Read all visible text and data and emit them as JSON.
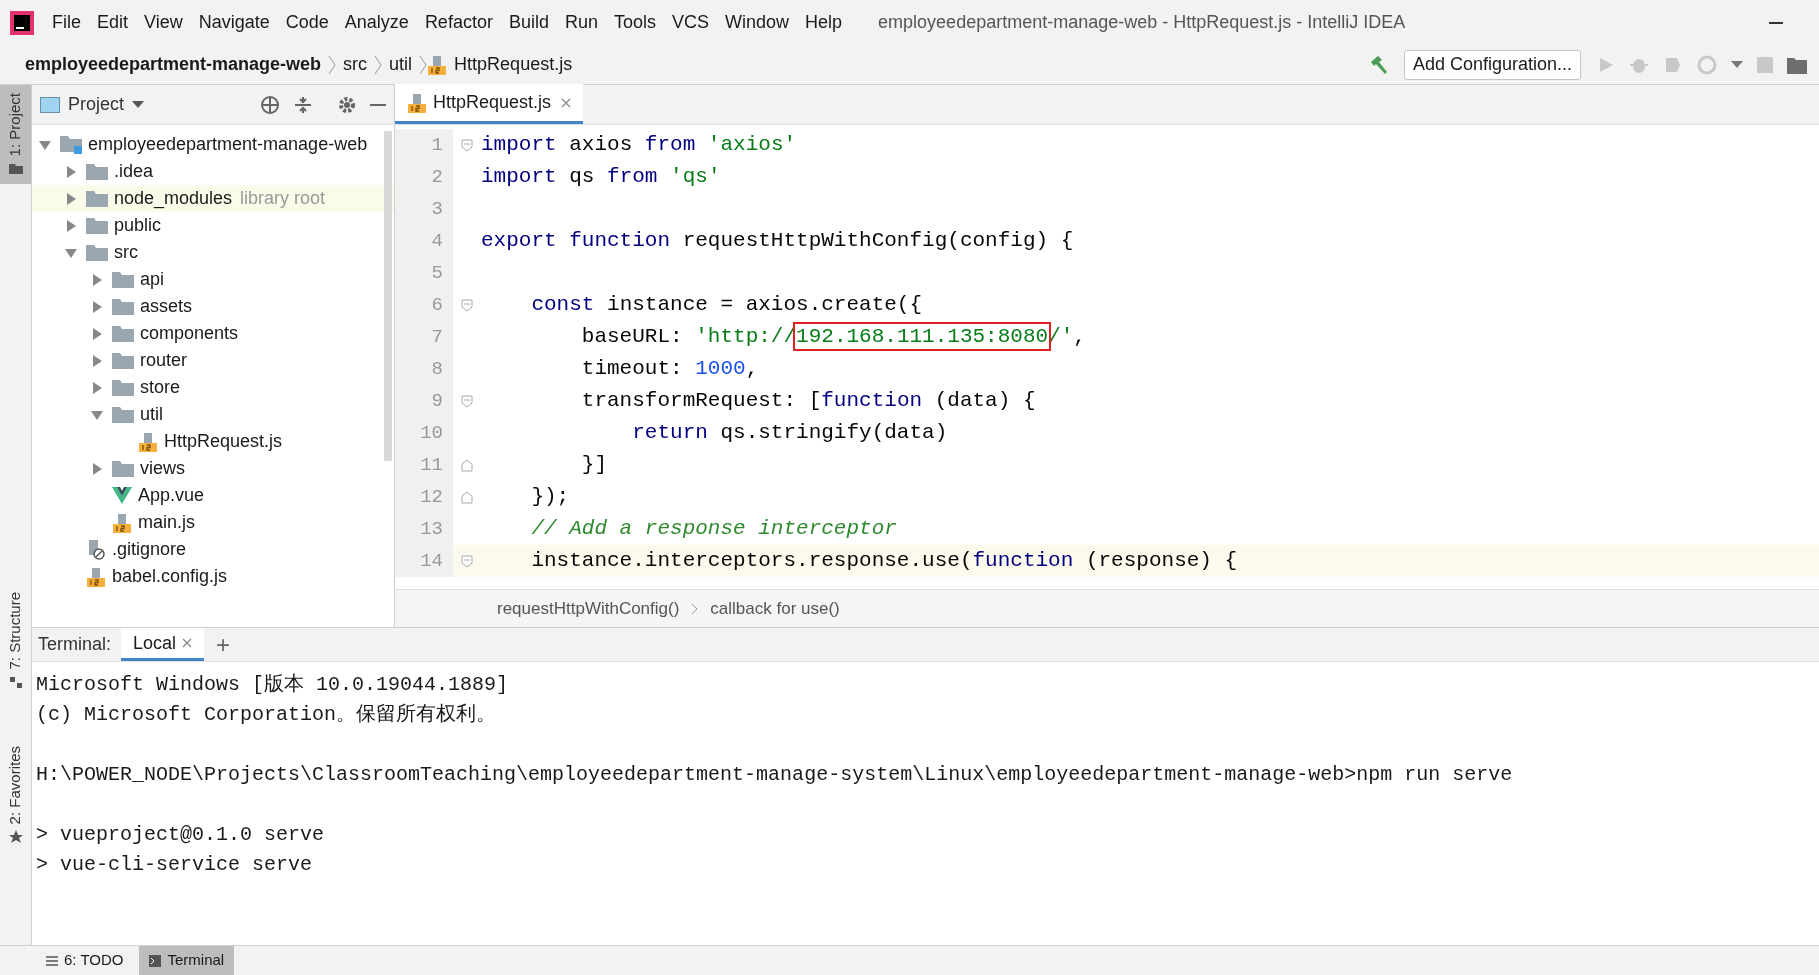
{
  "menu_bar": {
    "items": [
      "File",
      "Edit",
      "View",
      "Navigate",
      "Code",
      "Analyze",
      "Refactor",
      "Build",
      "Run",
      "Tools",
      "VCS",
      "Window",
      "Help"
    ],
    "title": "employeedepartment-manage-web - HttpRequest.js - IntelliJ IDEA"
  },
  "nav_bar": {
    "breadcrumbs": [
      "employeedepartment-manage-web",
      "src",
      "util",
      "HttpRequest.js"
    ],
    "run_config": "Add Configuration..."
  },
  "side_tabs": [
    {
      "label": "1: Project",
      "selected": true
    },
    {
      "label": "7: Structure",
      "selected": false
    },
    {
      "label": "2: Favorites",
      "selected": false
    }
  ],
  "project": {
    "title": "Project",
    "tree": [
      {
        "name": "employeedepartment-manage-web",
        "kind": "module",
        "expanded": true,
        "children": [
          {
            "name": ".idea",
            "kind": "folder",
            "expanded": false
          },
          {
            "name": "node_modules",
            "kind": "folder",
            "expanded": false,
            "note": "library root"
          },
          {
            "name": "public",
            "kind": "folder",
            "expanded": false
          },
          {
            "name": "src",
            "kind": "folder",
            "expanded": true,
            "children": [
              {
                "name": "api",
                "kind": "folder",
                "expanded": false
              },
              {
                "name": "assets",
                "kind": "folder",
                "expanded": false
              },
              {
                "name": "components",
                "kind": "folder",
                "expanded": false
              },
              {
                "name": "router",
                "kind": "folder",
                "expanded": false
              },
              {
                "name": "store",
                "kind": "folder",
                "expanded": false
              },
              {
                "name": "util",
                "kind": "folder",
                "expanded": true,
                "children": [
                  {
                    "name": "HttpRequest.js",
                    "kind": "js"
                  }
                ]
              },
              {
                "name": "views",
                "kind": "folder",
                "expanded": false
              },
              {
                "name": "App.vue",
                "kind": "vue"
              },
              {
                "name": "main.js",
                "kind": "js"
              }
            ]
          },
          {
            "name": ".gitignore",
            "kind": "ignore"
          },
          {
            "name": "babel.config.js",
            "kind": "js"
          }
        ]
      }
    ]
  },
  "editor": {
    "tabs": [
      {
        "label": "HttpRequest.js",
        "selected": true
      }
    ],
    "lines": [
      {
        "number": "1",
        "fold_start": true,
        "fold_end": false,
        "current": false,
        "tokens": [
          {
            "kind": "keyword",
            "text": "import"
          },
          {
            "kind": "plain",
            "text": " axios "
          },
          {
            "kind": "keyword",
            "text": "from"
          },
          {
            "kind": "string",
            "text": " 'axios'"
          }
        ]
      },
      {
        "number": "2",
        "fold_start": false,
        "fold_end": false,
        "current": false,
        "tokens": [
          {
            "kind": "keyword",
            "text": "import"
          },
          {
            "kind": "plain",
            "text": " qs "
          },
          {
            "kind": "keyword",
            "text": "from"
          },
          {
            "kind": "string",
            "text": " 'qs'"
          }
        ]
      },
      {
        "number": "3",
        "fold_start": false,
        "fold_end": false,
        "current": false
      },
      {
        "number": "4",
        "fold_start": false,
        "fold_end": false,
        "current": false,
        "tokens": [
          {
            "kind": "keyword",
            "text": "export function"
          },
          {
            "kind": "plain",
            "text": " requestHttpWithConfig(config) {"
          }
        ]
      },
      {
        "number": "5",
        "fold_start": false,
        "fold_end": false,
        "current": false
      },
      {
        "number": "6",
        "fold_start": true,
        "fold_end": false,
        "current": false,
        "tokens": [
          {
            "kind": "keyword",
            "text": "    const"
          },
          {
            "kind": "plain",
            "text": " instance = axios.create({"
          }
        ]
      },
      {
        "number": "7",
        "fold_start": false,
        "fold_end": false,
        "current": false,
        "tokens": [
          {
            "kind": "plain",
            "text": "        baseURL: "
          },
          {
            "kind": "string",
            "text": "'http://"
          },
          {
            "kind": "boxed_string",
            "text": "192.168.111.135:8080"
          },
          {
            "kind": "string",
            "text": "/'"
          },
          {
            "kind": "plain",
            "text": ","
          }
        ]
      },
      {
        "number": "8",
        "fold_start": false,
        "fold_end": false,
        "current": false,
        "tokens": [
          {
            "kind": "plain",
            "text": "        timeout: "
          },
          {
            "kind": "number",
            "text": "1000"
          },
          {
            "kind": "plain",
            "text": ","
          }
        ]
      },
      {
        "number": "9",
        "fold_start": true,
        "fold_end": false,
        "current": false,
        "tokens": [
          {
            "kind": "plain",
            "text": "        transformRequest: ["
          },
          {
            "kind": "keyword",
            "text": "function"
          },
          {
            "kind": "plain",
            "text": " (data) {"
          }
        ]
      },
      {
        "number": "10",
        "fold_start": false,
        "fold_end": false,
        "current": false,
        "tokens": [
          {
            "kind": "keyword",
            "text": "            return"
          },
          {
            "kind": "plain",
            "text": " qs.stringify(data)"
          }
        ]
      },
      {
        "number": "11",
        "fold_start": false,
        "fold_end": true,
        "current": false,
        "tokens": [
          {
            "kind": "plain",
            "text": "        }]"
          }
        ]
      },
      {
        "number": "12",
        "fold_start": false,
        "fold_end": true,
        "current": false,
        "tokens": [
          {
            "kind": "plain",
            "text": "    });"
          }
        ]
      },
      {
        "number": "13",
        "fold_start": false,
        "fold_end": false,
        "current": false,
        "tokens": [
          {
            "kind": "comment",
            "text": "    // Add a response interceptor"
          }
        ]
      },
      {
        "number": "14",
        "fold_start": true,
        "fold_end": false,
        "current": true,
        "tokens": [
          {
            "kind": "plain",
            "text": "    instance.interceptors.response.use("
          },
          {
            "kind": "keyword",
            "text": "function"
          },
          {
            "kind": "plain",
            "text": " (response) {"
          }
        ]
      }
    ],
    "breadcrumbs": [
      "requestHttpWithConfig()",
      "callback for use()"
    ]
  },
  "terminal": {
    "label": "Terminal:",
    "tabs": [
      {
        "label": "Local",
        "selected": true
      }
    ],
    "add": "+",
    "blocks": [
      [
        "Microsoft Windows [版本 10.0.19044.1889]",
        "(c) Microsoft Corporation。保留所有权利。"
      ],
      [
        "H:\\POWER_NODE\\Projects\\ClassroomTeaching\\employeedepartment-manage-system\\Linux\\employeedepartment-manage-web>npm run serve"
      ],
      [
        "> vueproject@0.1.0 serve",
        "> vue-cli-service serve"
      ]
    ]
  },
  "bottom_tabs": [
    {
      "label": "6: TODO",
      "selected": false
    },
    {
      "label": "Terminal",
      "selected": true
    }
  ]
}
